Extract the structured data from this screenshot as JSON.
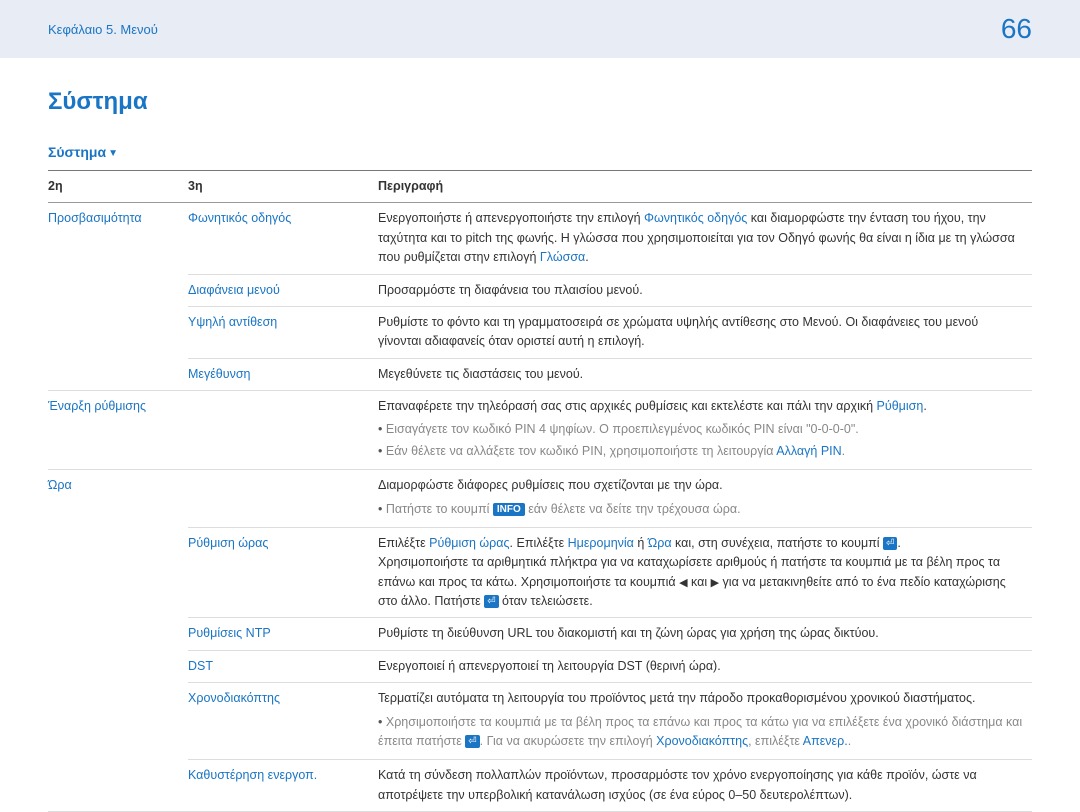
{
  "header": {
    "breadcrumb": "Κεφάλαιο 5. Μενού",
    "page_number": "66"
  },
  "title": "Σύστημα",
  "subtitle": "Σύστημα",
  "table": {
    "headers": {
      "c1": "2η",
      "c2": "3η",
      "c3": "Περιγραφή"
    },
    "accessibility": {
      "label": "Προσβασιμότητα",
      "voice_guide": {
        "label": "Φωνητικός οδηγός",
        "d1": "Ενεργοποιήστε ή απενεργοποιήστε την επιλογή ",
        "l1": "Φωνητικός οδηγός",
        "d2": " και διαμορφώστε την ένταση του ήχου, την ταχύτητα και το pitch της φωνής. Η γλώσσα που χρησιμοποιείται για τον Οδηγό φωνής θα είναι η ίδια με τη γλώσσα που ρυθμίζεται στην επιλογή ",
        "l2": "Γλώσσα",
        "d3": "."
      },
      "menu_transparency": {
        "label": "Διαφάνεια μενού",
        "desc": "Προσαρμόστε τη διαφάνεια του πλαισίου μενού."
      },
      "high_contrast": {
        "label": "Υψηλή αντίθεση",
        "desc": "Ρυθμίστε το φόντο και τη γραμματοσειρά σε χρώματα υψηλής αντίθεσης στο Μενού. Οι διαφάνειες του μενού γίνονται αδιαφανείς όταν οριστεί αυτή η επιλογή."
      },
      "enlarge": {
        "label": "Μεγέθυνση",
        "desc": "Μεγεθύνετε τις διαστάσεις του μενού."
      }
    },
    "start_setup": {
      "label": "Έναρξη ρύθμισης",
      "d1": "Επαναφέρετε την τηλεόρασή σας στις αρχικές ρυθμίσεις και εκτελέστε και πάλι την αρχική ",
      "l1": "Ρύθμιση",
      "d2": ".",
      "b1": "Εισαγάγετε τον κωδικό PIN 4 ψηφίων. Ο προεπιλεγμένος κωδικός PIN είναι \"0-0-0-0\".",
      "b2a": "Εάν θέλετε να αλλάξετε τον κωδικό PIN, χρησιμοποιήστε τη λειτουργία ",
      "b2l": "Αλλαγή PIN",
      "b2c": "."
    },
    "time": {
      "label": "Ώρα",
      "d1": "Διαμορφώστε διάφορες ρυθμίσεις που σχετίζονται με την ώρα.",
      "b1a": "Πατήστε το κουμπί ",
      "b1badge": "INFO",
      "b1b": " εάν θέλετε να δείτε την τρέχουσα ώρα.",
      "clock_set": {
        "label": "Ρύθμιση ώρας",
        "d1a": "Επιλέξτε ",
        "l1": "Ρύθμιση ώρας",
        "d1b": ". Επιλέξτε ",
        "l2": "Ημερομηνία",
        "d1c": " ή ",
        "l3": "Ώρα",
        "d1d": " και, στη συνέχεια, πατήστε το κουμπί ",
        "d1e": ".",
        "d2a": "Χρησιμοποιήστε τα αριθμητικά πλήκτρα για να καταχωρίσετε αριθμούς ή πατήστε τα κουμπιά με τα βέλη προς τα επάνω και προς τα κάτω. Χρησιμοποιήστε τα κουμπιά ",
        "d2b": " και ",
        "d2c": " για να μετακινηθείτε από το ένα πεδίο καταχώρισης στο άλλο. Πατήστε ",
        "d2d": " όταν τελειώσετε."
      },
      "ntp": {
        "label": "Ρυθμίσεις NTP",
        "desc": "Ρυθμίστε τη διεύθυνση URL του διακομιστή και τη ζώνη ώρας για χρήση της ώρας δικτύου."
      },
      "dst": {
        "label": "DST",
        "desc": "Ενεργοποιεί ή απενεργοποιεί τη λειτουργία DST (θερινή ώρα)."
      },
      "sleep_timer": {
        "label": "Χρονοδιακόπτης",
        "d1": "Τερματίζει αυτόματα τη λειτουργία του προϊόντος μετά την πάροδο προκαθορισμένου χρονικού διαστήματος.",
        "b1a": "Χρησιμοποιήστε τα κουμπιά με τα βέλη προς τα επάνω και προς τα κάτω για να επιλέξετε ένα χρονικό διάστημα και έπειτα πατήστε ",
        "b1b": ". Για να ακυρώσετε την επιλογή ",
        "l1": "Χρονοδιακόπτης",
        "b1c": ", επιλέξτε ",
        "l2": "Απενερ.",
        "b1d": "."
      },
      "power_on_delay": {
        "label": "Καθυστέρηση ενεργοπ.",
        "desc": "Κατά τη σύνδεση πολλαπλών προϊόντων, προσαρμόστε τον χρόνο ενεργοποίησης για κάθε προϊόν, ώστε να αποτρέψετε την υπερβολική κατανάλωση ισχύος (σε ένα εύρος 0–50 δευτερολέπτων)."
      }
    }
  }
}
